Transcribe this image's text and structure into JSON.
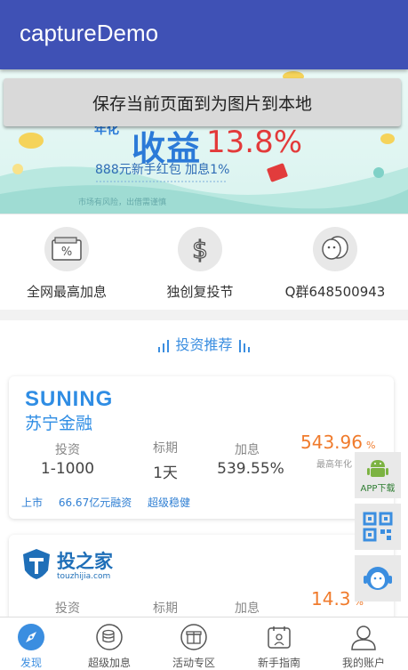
{
  "app": {
    "title": "captureDemo"
  },
  "save_button": {
    "label": "保存当前页面到为图片到本地"
  },
  "banner": {
    "prefix": "年化",
    "headline": "收益",
    "rate": "13.8%",
    "subtitle": "888元新手红包 加息1%",
    "risk": "市场有风险，出借需谨慎"
  },
  "features": [
    {
      "label": "全网最高加息",
      "icon": "percent-wallet-icon"
    },
    {
      "label": "独创复投节",
      "icon": "dollar-icon"
    },
    {
      "label": "Q群648500943",
      "icon": "qq-icon"
    }
  ],
  "section": {
    "title": "投资推荐"
  },
  "products": [
    {
      "brand": "SUNING",
      "brand_cn": "苏宁金融",
      "invest_label": "投资",
      "invest_value": "1-1000",
      "term_label": "标期",
      "term_value": "1天",
      "boost_label": "加息",
      "boost_value": "539.55%",
      "rate": "543.96",
      "rate_unit": "%",
      "rate_label": "最高年化",
      "tags": [
        "上市",
        "66.67亿元融资",
        "超级稳健"
      ]
    },
    {
      "brand": "投之家",
      "brand_url": "touzhijia.com",
      "invest_label": "投资",
      "term_label": "标期",
      "boost_label": "加息",
      "rate": "14.3",
      "rate_unit": "%"
    }
  ],
  "floating": {
    "app_download": "APP下载"
  },
  "tabs": [
    {
      "label": "发现",
      "icon": "compass-icon",
      "active": true
    },
    {
      "label": "超级加息",
      "icon": "coin-stack-icon",
      "active": false
    },
    {
      "label": "活动专区",
      "icon": "gift-icon",
      "active": false
    },
    {
      "label": "新手指南",
      "icon": "guide-icon",
      "active": false
    },
    {
      "label": "我的账户",
      "icon": "user-icon",
      "active": false
    }
  ],
  "colors": {
    "appbar": "#3f51b5",
    "accent": "#3b8ee0",
    "rate": "#f07b2c",
    "banner_rate": "#e33a3a"
  }
}
